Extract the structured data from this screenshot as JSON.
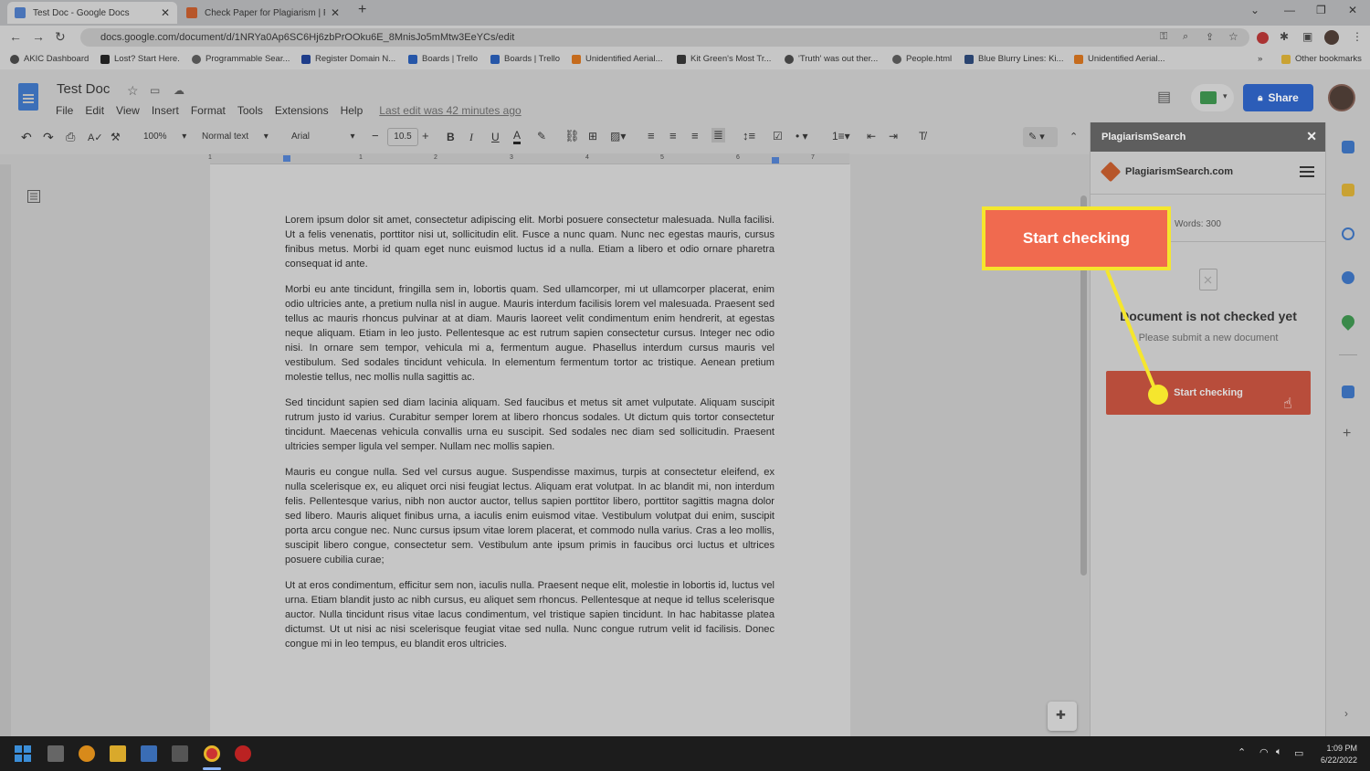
{
  "browser": {
    "tabs": [
      {
        "title": "Test Doc - Google Docs",
        "active": true
      },
      {
        "title": "Check Paper for Plagiarism | Plag",
        "active": false
      }
    ],
    "new_tab": "+",
    "url": "docs.google.com/document/d/1NRYa0Ap6SC6Hj6zbPrOOku6E_8MnisJo5mMtw3EeYCs/edit",
    "bookmarks": [
      "AKIC Dashboard",
      "Lost? Start Here.",
      "Programmable Sear...",
      "Register Domain N...",
      "Boards | Trello",
      "Boards | Trello",
      "Unidentified Aerial...",
      "Kit Green's Most Tr...",
      "'Truth' was out ther...",
      "People.html",
      "Blue Blurry Lines: Ki...",
      "Unidentified Aerial..."
    ],
    "other_bookmarks": "Other bookmarks"
  },
  "docs": {
    "title": "Test Doc",
    "menus": [
      "File",
      "Edit",
      "View",
      "Insert",
      "Format",
      "Tools",
      "Extensions",
      "Help"
    ],
    "last_edit": "Last edit was 42 minutes ago",
    "share_label": "Share",
    "toolbar": {
      "zoom": "100%",
      "style": "Normal text",
      "font": "Arial",
      "size": "10.5"
    },
    "ruler": [
      "1",
      "1",
      "2",
      "3",
      "4",
      "5",
      "6",
      "7"
    ],
    "paragraphs": [
      "Lorem ipsum dolor sit amet, consectetur adipiscing elit. Morbi posuere consectetur malesuada. Nulla facilisi. Ut a felis venenatis, porttitor nisi ut, sollicitudin elit. Fusce a nunc quam. Nunc nec egestas mauris, cursus finibus metus. Morbi id quam eget nunc euismod luctus id a nulla. Etiam a libero et odio ornare pharetra consequat id ante.",
      "Morbi eu ante tincidunt, fringilla sem in, lobortis quam. Sed ullamcorper, mi ut ullamcorper placerat, enim odio ultricies ante, a pretium nulla nisl in augue. Mauris interdum facilisis lorem vel malesuada. Praesent sed tellus ac mauris rhoncus pulvinar at at diam. Mauris laoreet velit condimentum enim hendrerit, at egestas neque aliquam. Etiam in leo justo. Pellentesque ac est rutrum sapien consectetur cursus. Integer nec odio nisi. In ornare sem tempor, vehicula mi a, fermentum augue. Phasellus interdum cursus mauris vel vestibulum. Sed sodales tincidunt vehicula. In elementum fermentum tortor ac tristique. Aenean pretium molestie tellus, nec mollis nulla sagittis ac.",
      "Sed tincidunt sapien sed diam lacinia aliquam. Sed faucibus et metus sit amet vulputate. Aliquam suscipit rutrum justo id varius. Curabitur semper lorem at libero rhoncus sodales. Ut dictum quis tortor consectetur tincidunt. Maecenas vehicula convallis urna eu suscipit. Sed sodales nec diam sed sollicitudin. Praesent ultricies semper ligula vel semper. Nullam nec mollis sapien.",
      "Mauris eu congue nulla. Sed vel cursus augue. Suspendisse maximus, turpis at consectetur eleifend, ex nulla scelerisque ex, eu aliquet orci nisi feugiat lectus. Aliquam erat volutpat. In ac blandit mi, non interdum felis. Pellentesque varius, nibh non auctor auctor, tellus sapien porttitor libero, porttitor sagittis magna dolor sed libero. Mauris aliquet finibus urna, a iaculis enim euismod vitae. Vestibulum volutpat dui enim, suscipit porta arcu congue nec. Nunc cursus ipsum vitae lorem placerat, et commodo nulla varius. Cras a leo mollis, suscipit libero congue, consectetur sem. Vestibulum ante ipsum primis in faucibus orci luctus et ultrices posuere cubilia curae;",
      "Ut at eros condimentum, efficitur sem non, iaculis nulla. Praesent neque elit, molestie in lobortis id, luctus vel urna. Etiam blandit justo ac nibh cursus, eu aliquet sem rhoncus. Pellentesque at neque id tellus scelerisque auctor. Nulla tincidunt risus vitae lacus condimentum, vel tristique sapien tincidunt. In hac habitasse platea dictumst. Ut ut nisi ac nisi scelerisque feugiat vitae sed nulla. Nunc congue rutrum velit id facilisis. Donec congue mi in leo tempus, eu blandit eros ultricies."
    ]
  },
  "panel": {
    "title": "PlagiarismSearch",
    "close": "✕",
    "logo": "PlagiarismSearch.com",
    "words": "Words: 300",
    "status": "Document is not checked yet",
    "hint": "Please submit a new document",
    "button": "Start checking"
  },
  "callout": {
    "text": "Start checking"
  },
  "taskbar": {
    "time": "1:09 PM",
    "date": "6/22/2022"
  },
  "colors": {
    "share": "#2c5db8",
    "start_button": "#b84d3b",
    "callout_fill": "#f06a4f",
    "callout_border": "#f5e62d"
  }
}
